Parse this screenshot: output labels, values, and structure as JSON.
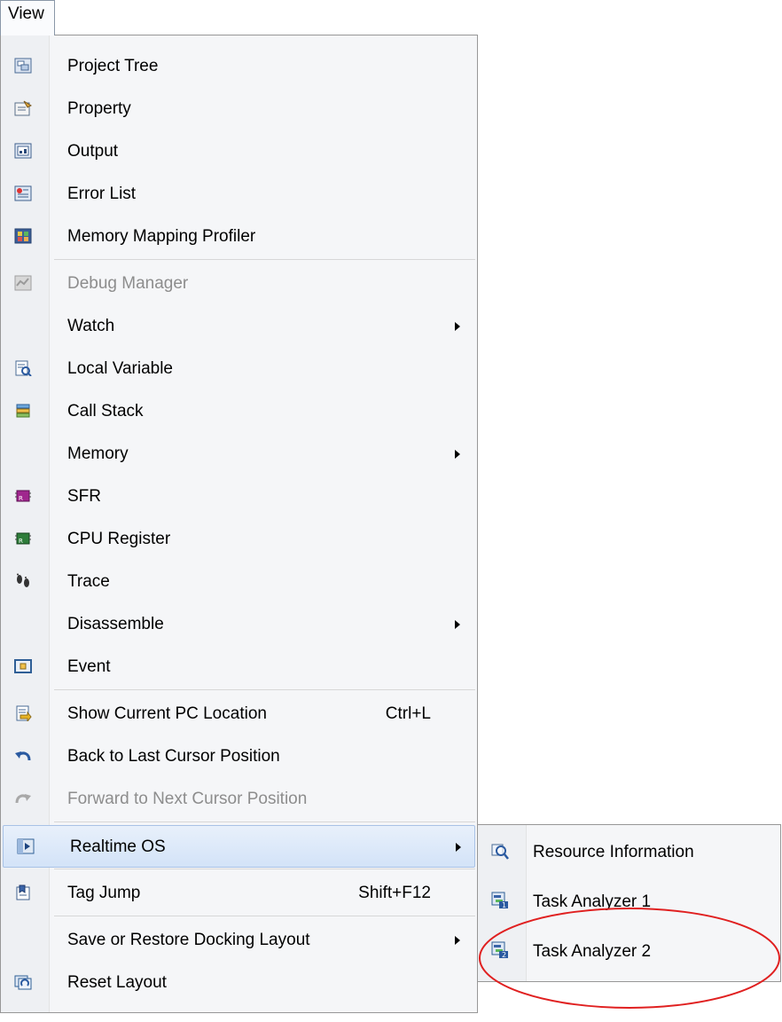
{
  "menubar": {
    "view_label": "View"
  },
  "menu": {
    "items": [
      {
        "label": "Project Tree",
        "icon": "project-tree-icon"
      },
      {
        "label": "Property",
        "icon": "property-icon"
      },
      {
        "label": "Output",
        "icon": "output-icon"
      },
      {
        "label": "Error List",
        "icon": "error-list-icon"
      },
      {
        "label": "Memory Mapping Profiler",
        "icon": "memory-mapping-profiler-icon"
      },
      {
        "label": "Debug Manager",
        "icon": "debug-manager-icon"
      },
      {
        "label": "Watch"
      },
      {
        "label": "Local Variable",
        "icon": "local-variable-icon"
      },
      {
        "label": "Call Stack",
        "icon": "call-stack-icon"
      },
      {
        "label": "Memory"
      },
      {
        "label": "SFR",
        "icon": "sfr-icon"
      },
      {
        "label": "CPU Register",
        "icon": "cpu-register-icon"
      },
      {
        "label": "Trace",
        "icon": "trace-icon"
      },
      {
        "label": "Disassemble"
      },
      {
        "label": "Event",
        "icon": "event-icon"
      },
      {
        "label": "Show Current PC Location",
        "shortcut": "Ctrl+L",
        "icon": "show-current-pc-icon"
      },
      {
        "label": "Back to Last Cursor Position",
        "icon": "back-arrow-icon"
      },
      {
        "label": "Forward to Next Cursor Position",
        "icon": "forward-arrow-icon"
      },
      {
        "label": "Realtime OS",
        "icon": "realtime-os-icon"
      },
      {
        "label": "Tag Jump",
        "shortcut": "Shift+F12",
        "icon": "tag-jump-icon"
      },
      {
        "label": "Save or Restore Docking Layout"
      },
      {
        "label": "Reset Layout",
        "icon": "reset-layout-icon"
      }
    ]
  },
  "submenu": {
    "items": [
      {
        "label": "Resource Information",
        "icon": "resource-information-icon"
      },
      {
        "label": "Task Analyzer 1",
        "icon": "task-analyzer-1-icon"
      },
      {
        "label": "Task Analyzer 2",
        "icon": "task-analyzer-2-icon"
      }
    ]
  },
  "colors": {
    "annotation": "#e02020",
    "hover_border": "#a8c2e6",
    "disabled_text": "#8d8d8d"
  }
}
